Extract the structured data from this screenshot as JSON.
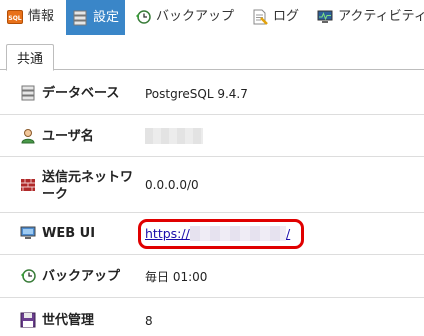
{
  "nav": {
    "items": [
      {
        "label": "情報",
        "icon": "sql-info-icon",
        "active": false
      },
      {
        "label": "設定",
        "icon": "settings-server-icon",
        "active": true
      },
      {
        "label": "バックアップ",
        "icon": "backup-clock-icon",
        "active": false
      },
      {
        "label": "ログ",
        "icon": "log-document-icon",
        "active": false
      },
      {
        "label": "アクティビティ",
        "icon": "activity-monitor-icon",
        "active": false
      }
    ],
    "active_color": "#3a86c8"
  },
  "subtab": {
    "label": "共通"
  },
  "rows": {
    "database": {
      "label": "データベース",
      "value": "PostgreSQL 9.4.7",
      "icon": "database-icon"
    },
    "username": {
      "label": "ユーザ名",
      "value": "",
      "icon": "user-icon"
    },
    "network": {
      "label_line1": "送信元ネットワ",
      "label_line2": "ーク",
      "value": "0.0.0.0/0",
      "icon": "firewall-icon"
    },
    "webui": {
      "label": "WEB UI",
      "url_prefix": "https://",
      "url_suffix": "/",
      "icon": "monitor-icon",
      "highlight_color": "#e00000"
    },
    "backup": {
      "label": "バックアップ",
      "value": "毎日 01:00",
      "icon": "backup-clock-icon"
    },
    "generations": {
      "label": "世代管理",
      "value": "8",
      "icon": "floppy-disk-icon"
    }
  }
}
